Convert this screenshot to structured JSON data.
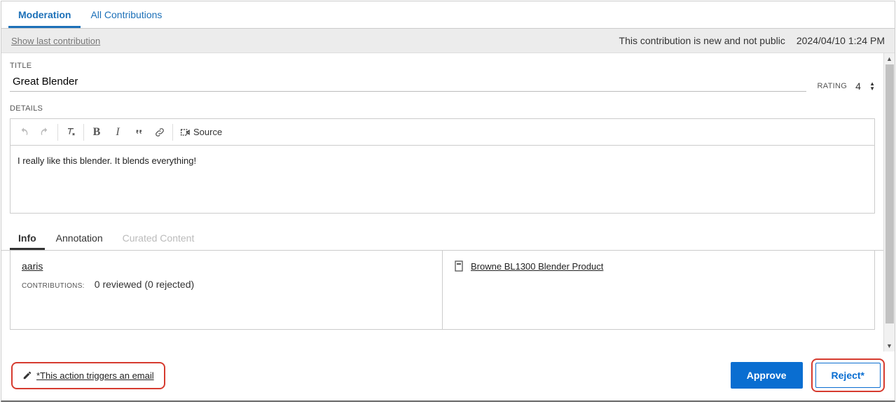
{
  "tabs": {
    "moderation": "Moderation",
    "all": "All Contributions"
  },
  "status": {
    "show_last": "Show last contribution",
    "text": "This contribution is new and not public",
    "date": "2024/04/10 1:24 PM"
  },
  "labels": {
    "title": "TITLE",
    "details": "DETAILS",
    "rating": "RATING",
    "contributions": "CONTRIBUTIONS:"
  },
  "form": {
    "title_value": "Great Blender",
    "rating_value": "4",
    "details_value": "I really like this blender. It blends everything!"
  },
  "toolbar": {
    "source_label": "Source"
  },
  "subtabs": {
    "info": "Info",
    "annotation": "Annotation",
    "curated": "Curated Content"
  },
  "info": {
    "user": "aaris",
    "contrib_stats": "0 reviewed (0 rejected)",
    "product": "Browne BL1300 Blender Product"
  },
  "footer": {
    "email_note": "*This action triggers an email",
    "approve": "Approve",
    "reject": "Reject*"
  }
}
